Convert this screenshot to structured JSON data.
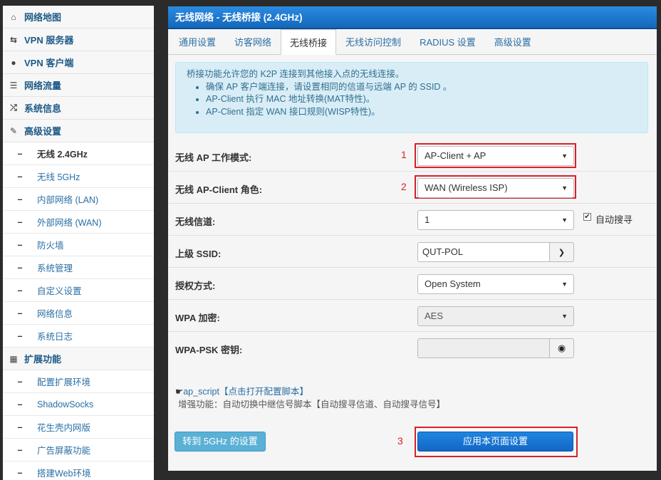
{
  "sidebar": {
    "items": [
      {
        "label": "网络地图",
        "icon": "home-icon",
        "glyph": "⌂",
        "type": "top"
      },
      {
        "label": "VPN 服务器",
        "icon": "exchange-icon",
        "glyph": "⇆",
        "type": "top"
      },
      {
        "label": "VPN 客户端",
        "icon": "globe-icon",
        "glyph": "●",
        "type": "top"
      },
      {
        "label": "网络流量",
        "icon": "list-icon",
        "glyph": "☰",
        "type": "top"
      },
      {
        "label": "系统信息",
        "icon": "shuffle-icon",
        "glyph": "⤮",
        "type": "top"
      },
      {
        "label": "高级设置",
        "icon": "wrench-icon",
        "glyph": "✎",
        "type": "top"
      },
      {
        "label": "无线 2.4GHz",
        "type": "sub",
        "active": true
      },
      {
        "label": "无线 5GHz",
        "type": "sub"
      },
      {
        "label": "内部网络 (LAN)",
        "type": "sub"
      },
      {
        "label": "外部网络 (WAN)",
        "type": "sub"
      },
      {
        "label": "防火墙",
        "type": "sub"
      },
      {
        "label": "系统管理",
        "type": "sub"
      },
      {
        "label": "自定义设置",
        "type": "sub"
      },
      {
        "label": "网络信息",
        "type": "sub"
      },
      {
        "label": "系统日志",
        "type": "sub"
      },
      {
        "label": "扩展功能",
        "icon": "grid-icon",
        "glyph": "▦",
        "type": "top"
      },
      {
        "label": "配置扩展环境",
        "type": "sub"
      },
      {
        "label": "ShadowSocks",
        "type": "sub"
      },
      {
        "label": "花生壳内网版",
        "type": "sub"
      },
      {
        "label": "广告屏蔽功能",
        "type": "sub"
      },
      {
        "label": "搭建Web环境",
        "type": "sub"
      }
    ]
  },
  "panel": {
    "title": "无线网络 - 无线桥接 (2.4GHz)",
    "tabs": [
      "通用设置",
      "访客网络",
      "无线桥接",
      "无线访问控制",
      "RADIUS 设置",
      "高级设置"
    ],
    "active_tab": 2
  },
  "info": {
    "intro": "桥接功能允许您的 K2P 连接到其他接入点的无线连接。",
    "bullets": [
      "确保 AP 客户端连接，请设置相同的信道与远端 AP 的 SSID 。",
      "AP-Client 执行 MAC 地址转换(MAT特性)。",
      "AP-Client 指定 WAN 接口规则(WISP特性)。"
    ]
  },
  "form": {
    "ap_mode": {
      "label": "无线 AP 工作模式:",
      "value": "AP-Client + AP",
      "marker": "1"
    },
    "client_role": {
      "label": "无线 AP-Client 角色:",
      "value": "WAN (Wireless ISP)",
      "marker": "2"
    },
    "channel": {
      "label": "无线信道:",
      "value": "1",
      "auto_label": "自动搜寻",
      "auto_checked": true
    },
    "ssid": {
      "label": "上级 SSID:",
      "value": "QUT-POL"
    },
    "auth": {
      "label": "授权方式:",
      "value": "Open System"
    },
    "wpa": {
      "label": "WPA 加密:",
      "value": "AES"
    },
    "psk": {
      "label": "WPA-PSK 密钥:",
      "value": ""
    }
  },
  "script": {
    "link_name": "ap_script",
    "link_action": "【点击打开配置脚本】",
    "description": "增强功能：自动切换中继信号脚本【自动搜寻信道、自动搜寻信号】"
  },
  "buttons": {
    "goto_5g": "转到 5GHz 的设置",
    "apply": "应用本页面设置",
    "apply_marker": "3"
  },
  "colors": {
    "accent": "#1467bb",
    "highlight": "#d9202a",
    "info_bg": "#d9edf7"
  }
}
